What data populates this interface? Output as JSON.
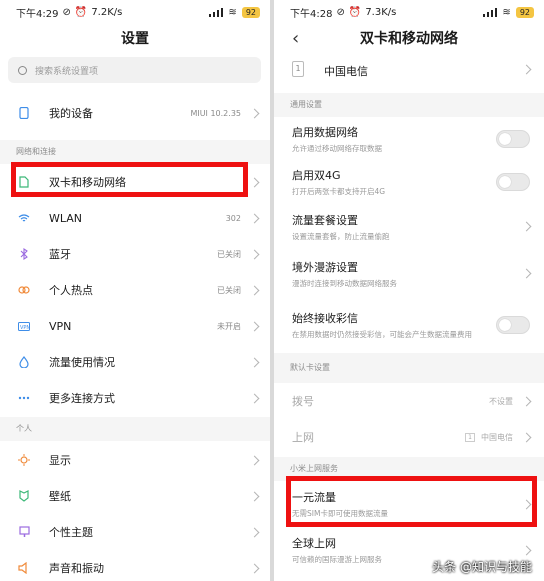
{
  "left": {
    "status": {
      "time": "下午4:29",
      "speed": "7.2K/s",
      "battery": "92"
    },
    "title": "设置",
    "search_placeholder": "搜索系统设置项",
    "my_device": {
      "label": "我的设备",
      "value": "MIUI 10.2.35"
    },
    "section_network": "网络和连接",
    "network_items": [
      {
        "label": "双卡和移动网络",
        "value": "",
        "icon": "sim-icon"
      },
      {
        "label": "WLAN",
        "value": "302",
        "icon": "wifi-icon"
      },
      {
        "label": "蓝牙",
        "value": "已关闭",
        "icon": "bluetooth-icon"
      },
      {
        "label": "个人热点",
        "value": "已关闭",
        "icon": "hotspot-icon"
      },
      {
        "label": "VPN",
        "value": "未开启",
        "icon": "vpn-icon"
      },
      {
        "label": "流量使用情况",
        "value": "",
        "icon": "data-usage-icon"
      },
      {
        "label": "更多连接方式",
        "value": "",
        "icon": "more-icon"
      }
    ],
    "section_personal": "个人",
    "personal_items": [
      {
        "label": "显示",
        "icon": "display-icon"
      },
      {
        "label": "壁纸",
        "icon": "wallpaper-icon"
      },
      {
        "label": "个性主题",
        "icon": "theme-icon"
      },
      {
        "label": "声音和振动",
        "icon": "sound-icon"
      }
    ]
  },
  "right": {
    "status": {
      "time": "下午4:28",
      "speed": "7.3K/s",
      "battery": "92"
    },
    "title": "双卡和移动网络",
    "back_glyph": "‹",
    "sim": {
      "number": "1",
      "label": "中国电信"
    },
    "section_general": "通用设置",
    "general": [
      {
        "title": "启用数据网络",
        "desc": "允许通过移动网络存取数据",
        "type": "toggle"
      },
      {
        "title": "启用双4G",
        "desc": "打开后两张卡都支持开启4G",
        "type": "toggle"
      },
      {
        "title": "流量套餐设置",
        "desc": "设置流量套餐，防止流量偷跑",
        "type": "chevron"
      },
      {
        "title": "境外漫游设置",
        "desc": "漫游时连接到移动数据网络服务",
        "type": "chevron"
      },
      {
        "title": "始终接收彩信",
        "desc": "在禁用数据时仍然接受彩信，可能会产生数据流量费用",
        "type": "toggle"
      }
    ],
    "section_default": "默认卡设置",
    "default": [
      {
        "title": "拨号",
        "value": "不设置"
      },
      {
        "title": "上网",
        "value": "中国电信",
        "badge": "1"
      }
    ],
    "section_mi": "小米上网服务",
    "mi": [
      {
        "title": "一元流量",
        "desc": "无需SIM卡即可使用数据流量"
      },
      {
        "title": "全球上网",
        "desc": "可信赖的国际漫游上网服务"
      }
    ]
  },
  "watermark": "头条 @知识与技能",
  "colors": {
    "highlight": "#ee1111",
    "accent": "#f4c542"
  }
}
